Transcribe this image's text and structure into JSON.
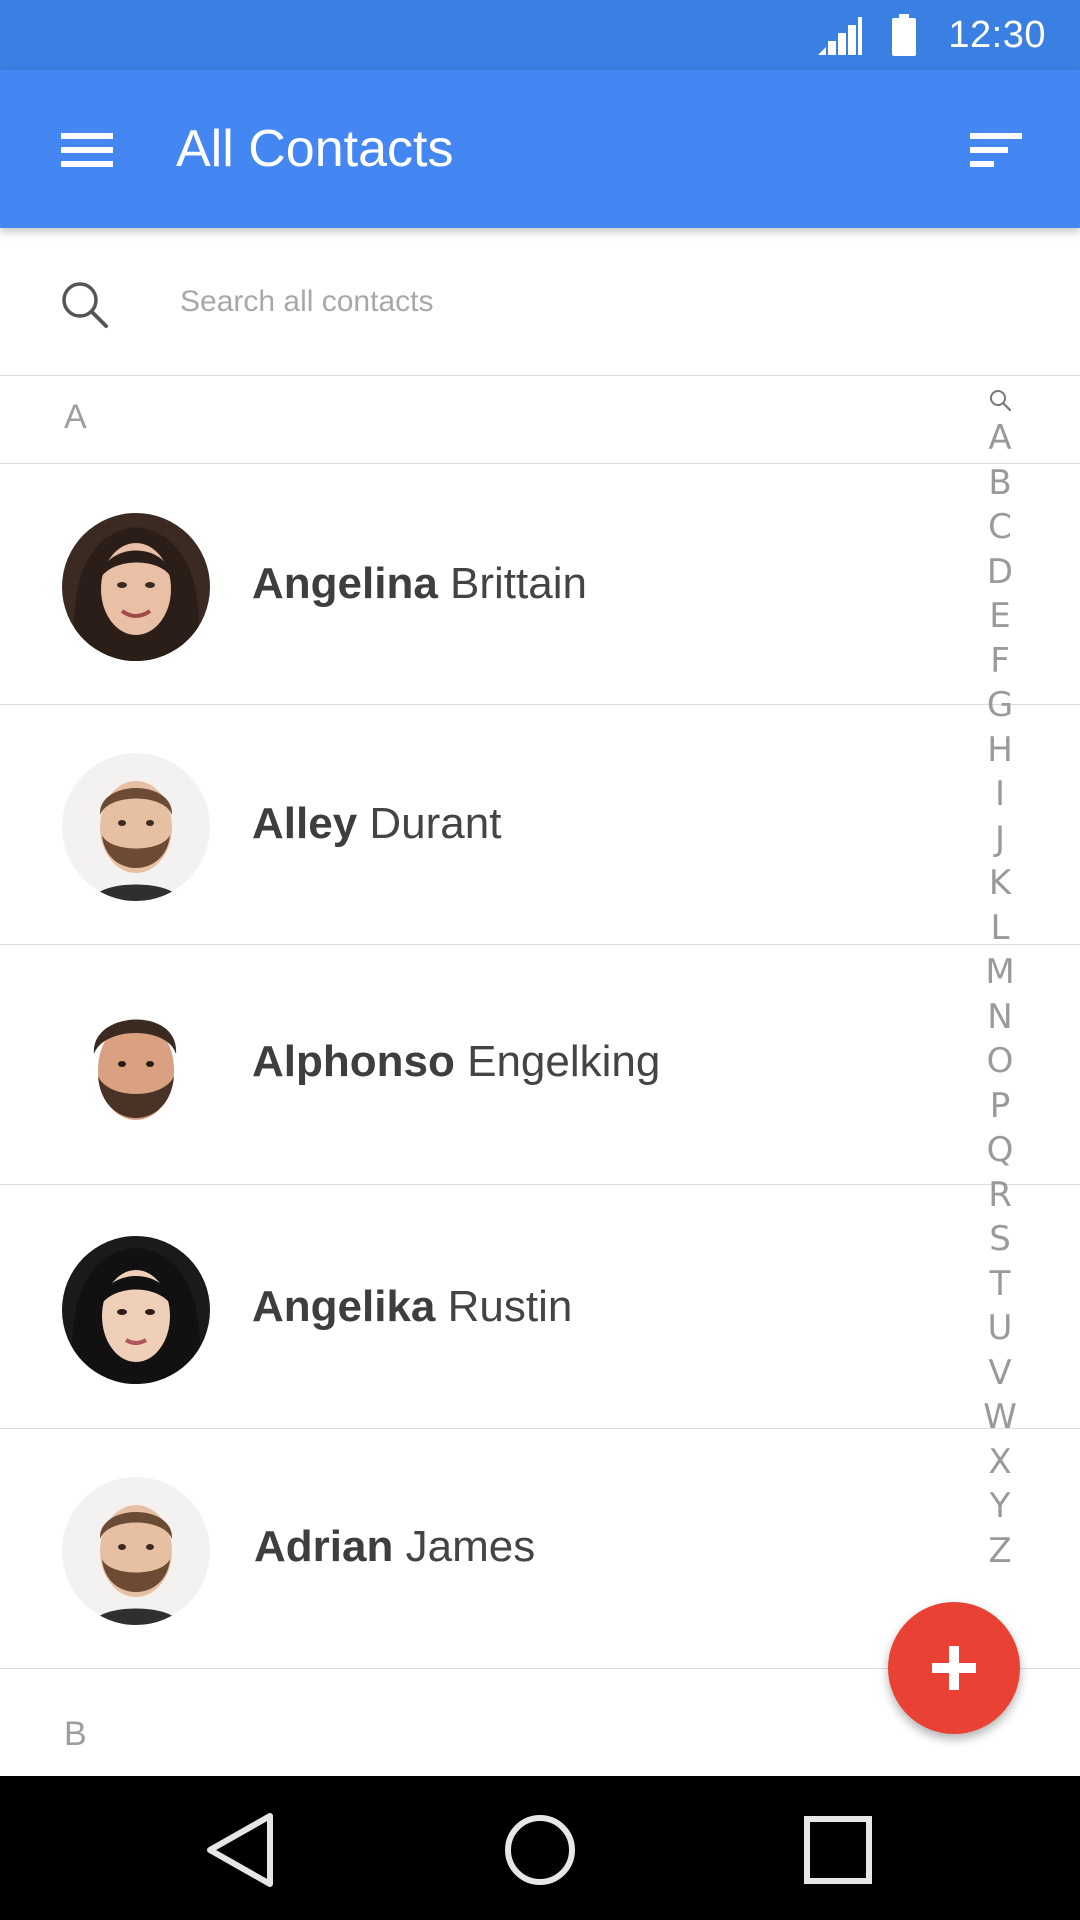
{
  "status_bar": {
    "time": "12:30",
    "signal_icon": "cell-signal-icon",
    "battery_icon": "battery-full-icon"
  },
  "app_bar": {
    "title": "All Contacts",
    "menu_icon": "hamburger-menu-icon",
    "sort_icon": "sort-icon"
  },
  "search": {
    "placeholder": "Search all contacts",
    "value": "",
    "icon": "search-icon"
  },
  "sections": [
    {
      "letter": "A",
      "contacts": [
        {
          "first": "Angelina",
          "last": "Brittain",
          "avatar": "avatar-woman-curly-hair"
        },
        {
          "first": "Alley",
          "last": "Durant",
          "avatar": "avatar-man-beard"
        },
        {
          "first": "Alphonso",
          "last": "Engelking",
          "avatar": "avatar-man-beard-dark"
        },
        {
          "first": "Angelika",
          "last": "Rustin",
          "avatar": "avatar-woman-dark-bob"
        },
        {
          "first": "Adrian",
          "last": "James",
          "avatar": "avatar-man-beard"
        }
      ]
    },
    {
      "letter": "B",
      "contacts": []
    }
  ],
  "alpha_index": {
    "search_icon": "search-icon",
    "letters": [
      "A",
      "B",
      "C",
      "D",
      "E",
      "F",
      "G",
      "H",
      "I",
      "J",
      "K",
      "L",
      "M",
      "N",
      "O",
      "P",
      "Q",
      "R",
      "S",
      "T",
      "U",
      "V",
      "W",
      "X",
      "Y",
      "Z"
    ]
  },
  "fab": {
    "icon": "plus-icon",
    "color": "#e94235"
  },
  "nav_bar": {
    "icons": [
      "back-triangle-icon",
      "home-circle-icon",
      "recents-square-icon"
    ]
  },
  "colors": {
    "status_bar": "#3a7fe2",
    "app_bar": "#4487f2",
    "accent": "#e94235"
  }
}
